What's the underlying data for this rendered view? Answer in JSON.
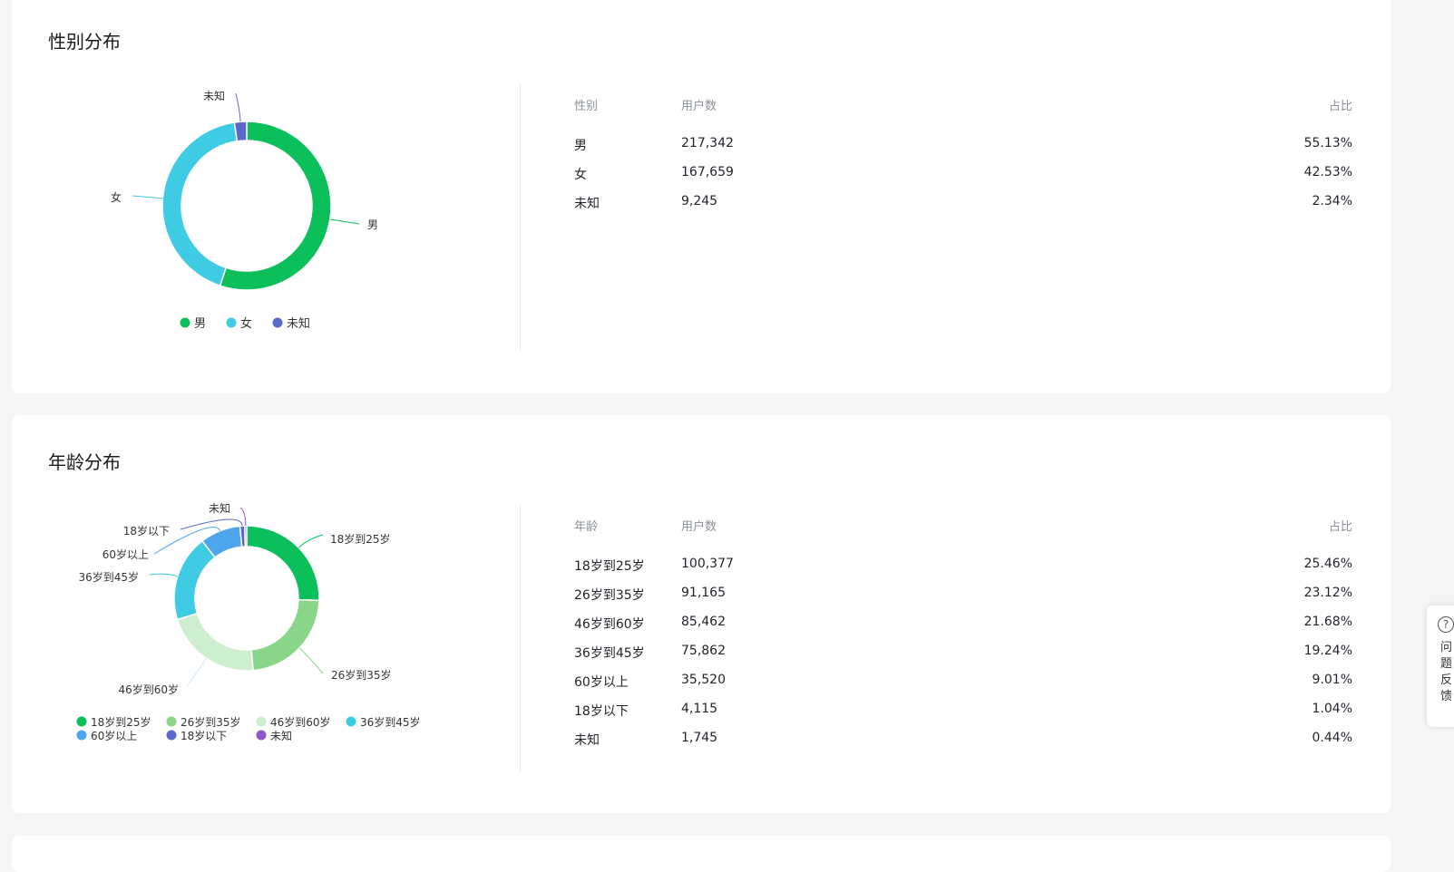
{
  "gender": {
    "title": "性别分布",
    "table": {
      "headers": [
        "性别",
        "用户数",
        "占比"
      ],
      "rows": [
        [
          "男",
          "217,342",
          "55.13%"
        ],
        [
          "女",
          "167,659",
          "42.53%"
        ],
        [
          "未知",
          "9,245",
          "2.34%"
        ]
      ]
    },
    "chart_data": {
      "type": "pie",
      "donut": true,
      "categories": [
        "男",
        "女",
        "未知"
      ],
      "values": [
        217342,
        167659,
        9245
      ],
      "colors": [
        "#0bbf5b",
        "#3ecbe3",
        "#5b68c9"
      ],
      "legend": "bottom"
    }
  },
  "age": {
    "title": "年龄分布",
    "table": {
      "headers": [
        "年龄",
        "用户数",
        "占比"
      ],
      "rows": [
        [
          "18岁到25岁",
          "100,377",
          "25.46%"
        ],
        [
          "26岁到35岁",
          "91,165",
          "23.12%"
        ],
        [
          "46岁到60岁",
          "85,462",
          "21.68%"
        ],
        [
          "36岁到45岁",
          "75,862",
          "19.24%"
        ],
        [
          "60岁以上",
          "35,520",
          "9.01%"
        ],
        [
          "18岁以下",
          "4,115",
          "1.04%"
        ],
        [
          "未知",
          "1,745",
          "0.44%"
        ]
      ]
    },
    "chart_data": {
      "type": "pie",
      "donut": true,
      "categories": [
        "18岁到25岁",
        "26岁到35岁",
        "46岁到60岁",
        "36岁到45岁",
        "60岁以上",
        "18岁以下",
        "未知"
      ],
      "values": [
        100377,
        91165,
        85462,
        75862,
        35520,
        4115,
        1745
      ],
      "colors": [
        "#0bbf5b",
        "#89d68a",
        "#cdefd0",
        "#3ecbe3",
        "#4da6ec",
        "#5b68c9",
        "#8f55cf"
      ],
      "legend": "bottom"
    }
  },
  "feedback": {
    "icon": "question-circle-icon",
    "label": "问题反馈"
  }
}
